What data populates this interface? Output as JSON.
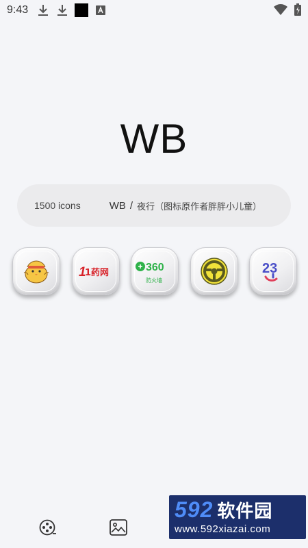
{
  "status_bar": {
    "time": "9:43",
    "left_icons": [
      "download-icon",
      "download-icon",
      "black-square-icon",
      "app-notification-icon"
    ],
    "right_icons": [
      "wifi-icon",
      "battery-charging-icon"
    ]
  },
  "header": {
    "title": "WB"
  },
  "info": {
    "count": "1500 icons",
    "name": "WB",
    "separator": "/",
    "note": "夜行（图标原作者胖胖小儿童）"
  },
  "preview_icons": [
    {
      "name": "chick-app-icon"
    },
    {
      "name": "1yao-app-icon",
      "label": "1药网"
    },
    {
      "name": "360-firewall-app-icon",
      "brand": "360",
      "sub": "防火墙"
    },
    {
      "name": "steering-wheel-app-icon"
    },
    {
      "name": "23-app-icon",
      "label": "23"
    }
  ],
  "bottom_nav": [
    {
      "name": "film-reel-icon"
    },
    {
      "name": "wallpaper-icon"
    }
  ],
  "watermark": {
    "number": "592",
    "brand": "软件园",
    "url": "www.592xiazai.com"
  },
  "colors": {
    "background": "#f4f5f8",
    "pill": "#ebebed",
    "watermark_bg": "#1c2f6b",
    "watermark_accent": "#4f8cf7",
    "360_green": "#2fb24a"
  }
}
